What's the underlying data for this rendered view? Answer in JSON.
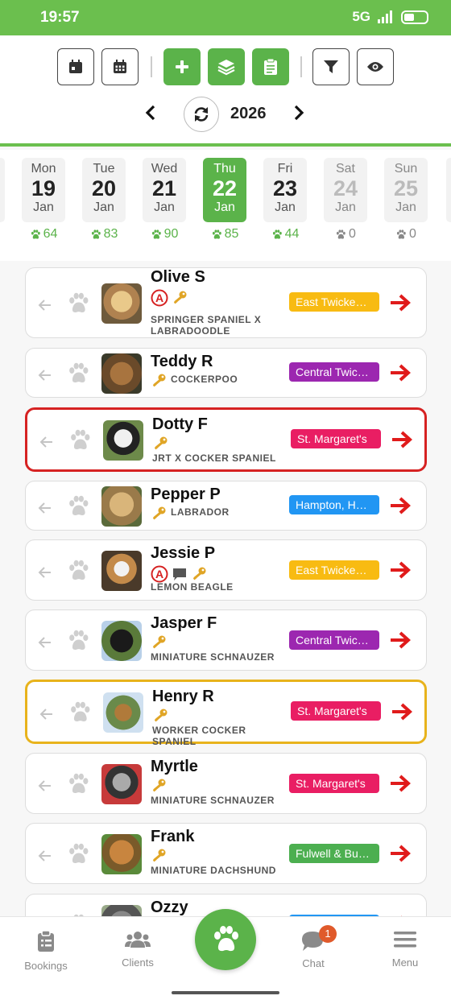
{
  "status": {
    "time": "19:57",
    "network": "5G"
  },
  "toolbar": {
    "buttons": [
      {
        "name": "calendar-day-button",
        "icon": "calendar-day-icon",
        "style": "white"
      },
      {
        "name": "calendar-week-button",
        "icon": "calendar-grid-icon",
        "style": "white"
      },
      {
        "name": "add-button",
        "icon": "plus-icon",
        "style": "green"
      },
      {
        "name": "layers-button",
        "icon": "layers-icon",
        "style": "green"
      },
      {
        "name": "clipboard-button",
        "icon": "clipboard-icon",
        "style": "green"
      },
      {
        "name": "filter-button",
        "icon": "filter-icon",
        "style": "white"
      },
      {
        "name": "view-button",
        "icon": "eye-icon",
        "style": "white"
      }
    ],
    "year": "2026"
  },
  "days": [
    {
      "day": "Mon",
      "num": "19",
      "month": "Jan",
      "count": "64",
      "selected": false,
      "weekend": false
    },
    {
      "day": "Tue",
      "num": "20",
      "month": "Jan",
      "count": "83",
      "selected": false,
      "weekend": false
    },
    {
      "day": "Wed",
      "num": "21",
      "month": "Jan",
      "count": "90",
      "selected": false,
      "weekend": false
    },
    {
      "day": "Thu",
      "num": "22",
      "month": "Jan",
      "count": "85",
      "selected": true,
      "weekend": false
    },
    {
      "day": "Fri",
      "num": "23",
      "month": "Jan",
      "count": "44",
      "selected": false,
      "weekend": false
    },
    {
      "day": "Sat",
      "num": "24",
      "month": "Jan",
      "count": "0",
      "selected": false,
      "weekend": true
    },
    {
      "day": "Sun",
      "num": "25",
      "month": "Jan",
      "count": "0",
      "selected": false,
      "weekend": true
    }
  ],
  "bookings": [
    {
      "name": "Olive S",
      "breed": "SPRINGER SPANIEL X LABRADOODLE",
      "icons": [
        "alert-icon",
        "key-icon"
      ],
      "area": "East Twickenham",
      "area_color": "#f8bb12",
      "highlight": "none"
    },
    {
      "name": "Teddy R",
      "breed": "COCKERPOO",
      "icons": [
        "key-icon"
      ],
      "area": "Central Twickenham",
      "area_color": "#9c27b0",
      "highlight": "none"
    },
    {
      "name": "Dotty F",
      "breed": "JRT X COCKER SPANIEL",
      "icons": [
        "key-icon"
      ],
      "area": "St. Margaret's",
      "area_color": "#e91e63",
      "highlight": "red"
    },
    {
      "name": "Pepper P",
      "breed": "LABRADOR",
      "icons": [
        "key-icon"
      ],
      "area": "Hampton, Hampton Hill",
      "area_color": "#2196f3",
      "highlight": "none"
    },
    {
      "name": "Jessie P",
      "breed": "LEMON BEAGLE",
      "icons": [
        "alert-icon",
        "comment-icon",
        "key-icon"
      ],
      "area": "East Twickenham",
      "area_color": "#f8bb12",
      "highlight": "none"
    },
    {
      "name": "Jasper F",
      "breed": "MINIATURE SCHNAUZER",
      "icons": [
        "key-icon"
      ],
      "area": "Central Twickenham",
      "area_color": "#9c27b0",
      "highlight": "none"
    },
    {
      "name": "Henry R",
      "breed": "WORKER COCKER SPANIEL",
      "icons": [
        "key-icon"
      ],
      "area": "St. Margaret's",
      "area_color": "#e91e63",
      "highlight": "amber"
    },
    {
      "name": "Myrtle",
      "breed": "MINIATURE SCHNAUZER",
      "icons": [
        "key-icon"
      ],
      "area": "St. Margaret's",
      "area_color": "#e91e63",
      "highlight": "none"
    },
    {
      "name": "Frank",
      "breed": "MINIATURE DACHSHUND",
      "icons": [
        "key-icon"
      ],
      "area": "Fulwell & Bushy",
      "area_color": "#4caf50",
      "highlight": "none"
    },
    {
      "name": "Ozzy",
      "breed": "",
      "icons": [],
      "area": "Hampton, Hampton Hill",
      "area_color": "#2196f3",
      "highlight": "none"
    }
  ],
  "nav": {
    "bookings": "Bookings",
    "clients": "Clients",
    "chat": "Chat",
    "chat_badge": "1",
    "menu": "Menu"
  },
  "colors": {
    "brand_green": "#5bb34a",
    "status_green": "#6bbf4e",
    "go_arrow": "#e01b1b",
    "key": "#e0a526",
    "alert": "#d62222"
  }
}
